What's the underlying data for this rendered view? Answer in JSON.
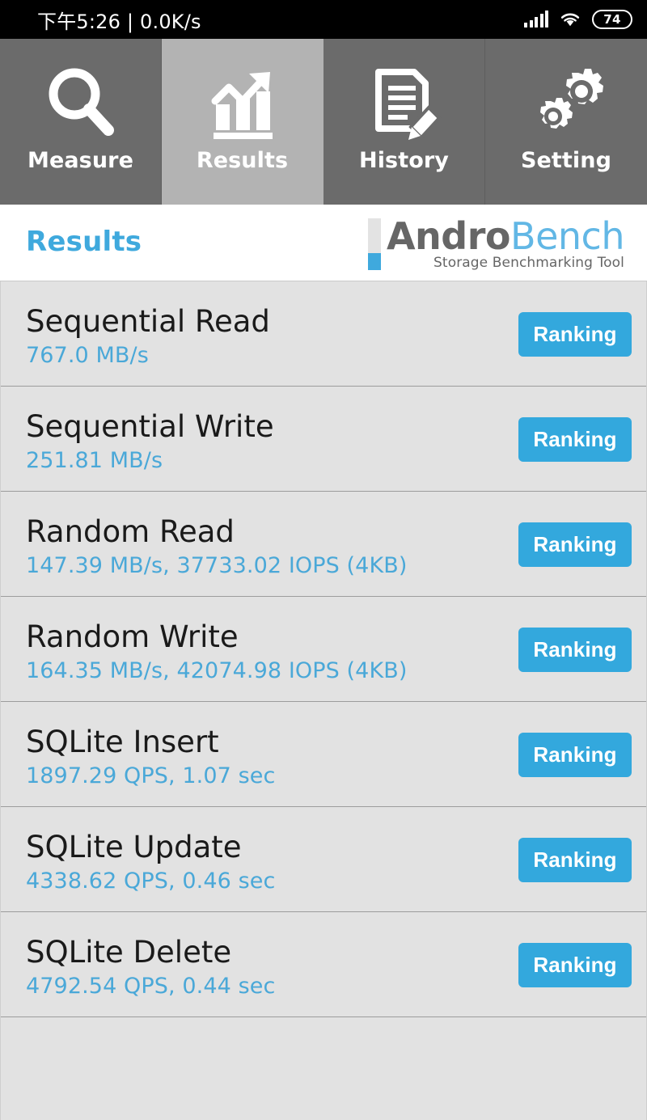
{
  "statusbar": {
    "time_and_net": "下午5:26 | 0.0K/s",
    "signal_icon": "signal-bars-icon",
    "wifi_icon": "wifi-icon",
    "battery_level": "74"
  },
  "tabs": [
    {
      "label": "Measure",
      "icon": "magnifier-icon",
      "active": false
    },
    {
      "label": "Results",
      "icon": "bar-chart-arrow-icon",
      "active": true
    },
    {
      "label": "History",
      "icon": "document-pencil-icon",
      "active": false
    },
    {
      "label": "Setting",
      "icon": "gears-icon",
      "active": false
    }
  ],
  "header": {
    "page_title": "Results",
    "logo_primary": "Andro",
    "logo_secondary": "Bench",
    "logo_subtitle": "Storage Benchmarking Tool"
  },
  "results": [
    {
      "name": "Sequential Read",
      "value": "767.0 MB/s",
      "button": "Ranking"
    },
    {
      "name": "Sequential Write",
      "value": "251.81 MB/s",
      "button": "Ranking"
    },
    {
      "name": "Random Read",
      "value": "147.39 MB/s, 37733.02 IOPS (4KB)",
      "button": "Ranking"
    },
    {
      "name": "Random Write",
      "value": "164.35 MB/s, 42074.98 IOPS (4KB)",
      "button": "Ranking"
    },
    {
      "name": "SQLite Insert",
      "value": "1897.29 QPS, 1.07 sec",
      "button": "Ranking"
    },
    {
      "name": "SQLite Update",
      "value": "4338.62 QPS, 0.46 sec",
      "button": "Ranking"
    },
    {
      "name": "SQLite Delete",
      "value": "4792.54 QPS, 0.44 sec",
      "button": "Ranking"
    }
  ],
  "colors": {
    "accent_blue": "#33a8dd",
    "value_blue": "#4aa8d8",
    "title_blue": "#3fa9dd",
    "tab_inactive": "#6b6b6b",
    "tab_active": "#b3b3b3",
    "list_bg": "#e2e2e2"
  }
}
